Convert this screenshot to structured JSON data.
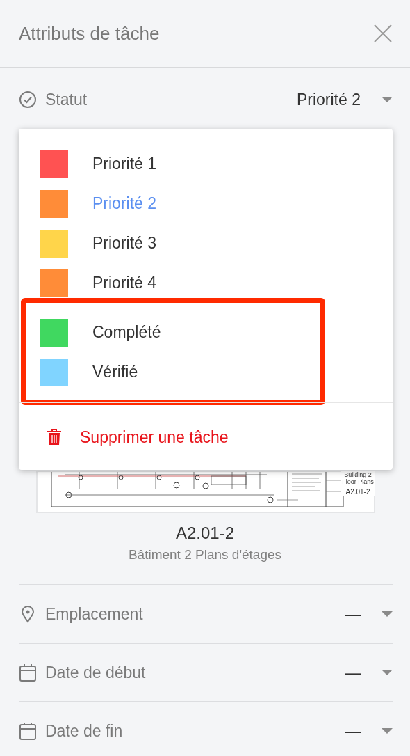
{
  "header": {
    "title": "Attributs de tâche"
  },
  "status": {
    "label": "Statut",
    "value": "Priorité 2"
  },
  "dropdown": {
    "options": [
      {
        "label": "Priorité 1",
        "color": "#ff5252",
        "selected": false,
        "highlighted": false
      },
      {
        "label": "Priorité 2",
        "color": "#ff8c38",
        "selected": true,
        "highlighted": false
      },
      {
        "label": "Priorité 3",
        "color": "#ffd54a",
        "selected": false,
        "highlighted": false
      },
      {
        "label": "Priorité 4",
        "color": "#ff8c38",
        "selected": false,
        "highlighted": false
      },
      {
        "label": "Complété",
        "color": "#40d860",
        "selected": false,
        "highlighted": true
      },
      {
        "label": "Vérifié",
        "color": "#80d4ff",
        "selected": false,
        "highlighted": true
      }
    ],
    "delete_action": "Supprimer une tâche"
  },
  "sheet": {
    "title_block": "Building 2 Floor Plans",
    "title_block_number": "A2.01-2",
    "number": "A2.01-2",
    "name": "Bâtiment 2 Plans d'étages"
  },
  "fields": [
    {
      "kind": "location",
      "label": "Emplacement",
      "value": "—"
    },
    {
      "kind": "date",
      "label": "Date de début",
      "value": "—"
    },
    {
      "kind": "date",
      "label": "Date de fin",
      "value": "—"
    }
  ]
}
